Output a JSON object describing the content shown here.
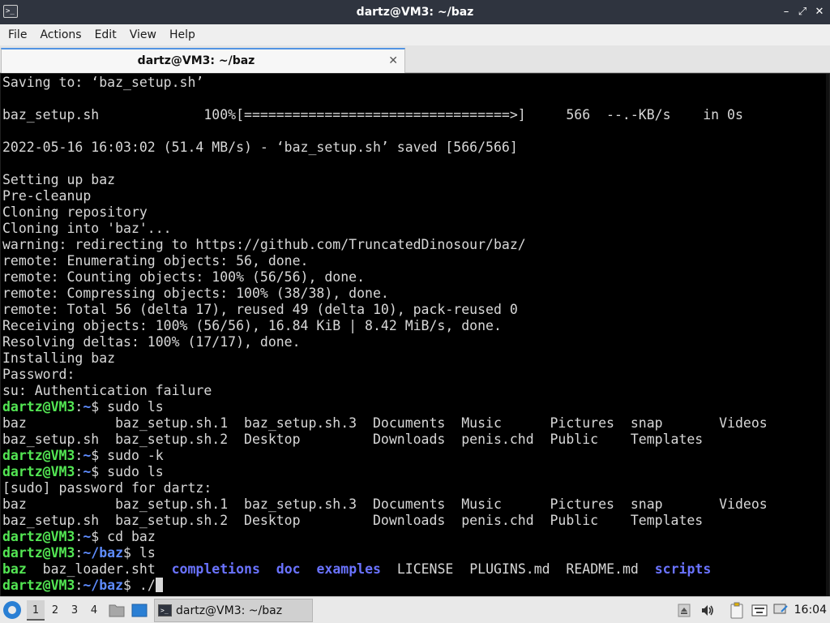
{
  "window": {
    "title": "dartz@VM3: ~/baz",
    "controls": {
      "minimize": "–",
      "maximize": "⤢",
      "close": "✕"
    }
  },
  "menu": {
    "items": [
      {
        "label": "File"
      },
      {
        "label": "Actions"
      },
      {
        "label": "Edit"
      },
      {
        "label": "View"
      },
      {
        "label": "Help"
      }
    ]
  },
  "tabs": [
    {
      "label": "dartz@VM3: ~/baz",
      "active": true,
      "close": "✕"
    }
  ],
  "terminal": {
    "colors": {
      "background": "#000000",
      "text": "#d8d8d8",
      "prompt_user": "#53e653",
      "prompt_path": "#5e8cff",
      "directory": "#6a73ff"
    },
    "lines": [
      [
        {
          "t": "Saving to: ‘baz_setup.sh’"
        }
      ],
      [],
      [
        {
          "t": "baz_setup.sh             100%[=================================>]     566  --.-KB/s    in 0s"
        }
      ],
      [],
      [
        {
          "t": "2022-05-16 16:03:02 (51.4 MB/s) - ‘baz_setup.sh’ saved [566/566]"
        }
      ],
      [],
      [
        {
          "t": "Setting up baz"
        }
      ],
      [
        {
          "t": "Pre-cleanup"
        }
      ],
      [
        {
          "t": "Cloning repository"
        }
      ],
      [
        {
          "t": "Cloning into 'baz'..."
        }
      ],
      [
        {
          "t": "warning: redirecting to https://github.com/TruncatedDinosour/baz/"
        }
      ],
      [
        {
          "t": "remote: Enumerating objects: 56, done."
        }
      ],
      [
        {
          "t": "remote: Counting objects: 100% (56/56), done."
        }
      ],
      [
        {
          "t": "remote: Compressing objects: 100% (38/38), done."
        }
      ],
      [
        {
          "t": "remote: Total 56 (delta 17), reused 49 (delta 10), pack-reused 0"
        }
      ],
      [
        {
          "t": "Receiving objects: 100% (56/56), 16.84 KiB | 8.42 MiB/s, done."
        }
      ],
      [
        {
          "t": "Resolving deltas: 100% (17/17), done."
        }
      ],
      [
        {
          "t": "Installing baz"
        }
      ],
      [
        {
          "t": "Password:"
        }
      ],
      [
        {
          "t": "su: Authentication failure"
        }
      ],
      [
        {
          "t": "dartz@VM3",
          "c": "p-user"
        },
        {
          "t": ":"
        },
        {
          "t": "~",
          "c": "p-path"
        },
        {
          "t": "$ sudo ls"
        }
      ],
      [
        {
          "t": "baz           baz_setup.sh.1  baz_setup.sh.3  Documents  Music      Pictures  snap       Videos"
        }
      ],
      [
        {
          "t": "baz_setup.sh  baz_setup.sh.2  Desktop         Downloads  penis.chd  Public    Templates"
        }
      ],
      [
        {
          "t": "dartz@VM3",
          "c": "p-user"
        },
        {
          "t": ":"
        },
        {
          "t": "~",
          "c": "p-path"
        },
        {
          "t": "$ sudo -k"
        }
      ],
      [
        {
          "t": "dartz@VM3",
          "c": "p-user"
        },
        {
          "t": ":"
        },
        {
          "t": "~",
          "c": "p-path"
        },
        {
          "t": "$ sudo ls"
        }
      ],
      [
        {
          "t": "[sudo] password for dartz:"
        }
      ],
      [
        {
          "t": "baz           baz_setup.sh.1  baz_setup.sh.3  Documents  Music      Pictures  snap       Videos"
        }
      ],
      [
        {
          "t": "baz_setup.sh  baz_setup.sh.2  Desktop         Downloads  penis.chd  Public    Templates"
        }
      ],
      [
        {
          "t": "dartz@VM3",
          "c": "p-user"
        },
        {
          "t": ":"
        },
        {
          "t": "~",
          "c": "p-path"
        },
        {
          "t": "$ cd baz"
        }
      ],
      [
        {
          "t": "dartz@VM3",
          "c": "p-user"
        },
        {
          "t": ":"
        },
        {
          "t": "~/baz",
          "c": "p-path"
        },
        {
          "t": "$ ls"
        }
      ],
      [
        {
          "t": "baz",
          "c": "exe"
        },
        {
          "t": "  baz_loader.sht  "
        },
        {
          "t": "completions",
          "c": "dir"
        },
        {
          "t": "  "
        },
        {
          "t": "doc",
          "c": "dir"
        },
        {
          "t": "  "
        },
        {
          "t": "examples",
          "c": "dir"
        },
        {
          "t": "  LICENSE  PLUGINS.md  README.md  "
        },
        {
          "t": "scripts",
          "c": "dir"
        }
      ],
      [
        {
          "t": "dartz@VM3",
          "c": "p-user"
        },
        {
          "t": ":"
        },
        {
          "t": "~/baz",
          "c": "p-path"
        },
        {
          "t": "$ ./"
        },
        {
          "cursor": true
        }
      ]
    ]
  },
  "taskbar": {
    "workspaces": [
      {
        "label": "1",
        "active": true
      },
      {
        "label": "2",
        "active": false
      },
      {
        "label": "3",
        "active": false
      },
      {
        "label": "4",
        "active": false
      }
    ],
    "launchers": [
      {
        "icon": "file-manager-icon"
      },
      {
        "icon": "show-desktop-icon"
      }
    ],
    "task": {
      "label": "dartz@VM3: ~/baz",
      "icon": "terminal-icon"
    },
    "tray": [
      {
        "icon": "eject-icon"
      },
      {
        "icon": "volume-icon"
      },
      {
        "icon": "clipboard-icon"
      },
      {
        "icon": "keyboard-icon"
      },
      {
        "icon": "network-icon"
      }
    ],
    "clock": "16:04"
  }
}
